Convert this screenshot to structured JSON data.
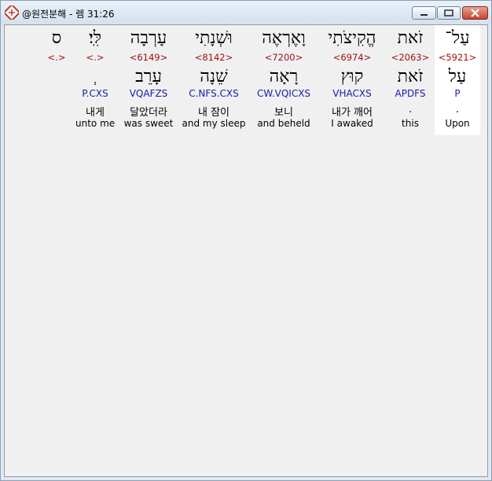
{
  "window": {
    "title": "@원전분해 - 렘 31:26"
  },
  "columns": [
    {
      "hebrew": "עַל־",
      "number": "<5921>",
      "lemma": "עַל",
      "code": "P",
      "korean": ".",
      "english": "Upon"
    },
    {
      "hebrew": "זֹאת",
      "number": "<2063>",
      "lemma": "זֹאת",
      "code": "APDFS",
      "korean": ".",
      "english": "this"
    },
    {
      "hebrew": "הֱקִיצֹתִי",
      "number": "<6974>",
      "lemma": "קוּץ",
      "code": "VHACXS",
      "korean": "내가 깨어",
      "english": "I awaked"
    },
    {
      "hebrew": "וָאֶרְאֶה",
      "number": "<7200>",
      "lemma": "רָאָה",
      "code": "CW.VQICXS",
      "korean": "보니",
      "english": "and beheld"
    },
    {
      "hebrew": "וּשְׁנָתִי",
      "number": "<8142>",
      "lemma": "שֵׁנָה",
      "code": "C.NFS.CXS",
      "korean": "내 잠이",
      "english": "and my sleep"
    },
    {
      "hebrew": "עָרְבָה",
      "number": "<6149>",
      "lemma": "עָרֵב",
      "code": "VQAFZS",
      "korean": "달았더라",
      "english": "was sweet"
    },
    {
      "hebrew": "לִּֽי׃",
      "number": "<.>",
      "lemma": "ְ",
      "code": "P.CXS",
      "korean": "내게",
      "english": "unto me"
    },
    {
      "hebrew": "ס",
      "number": "<.>",
      "lemma": "",
      "code": "",
      "korean": "",
      "english": ""
    }
  ]
}
